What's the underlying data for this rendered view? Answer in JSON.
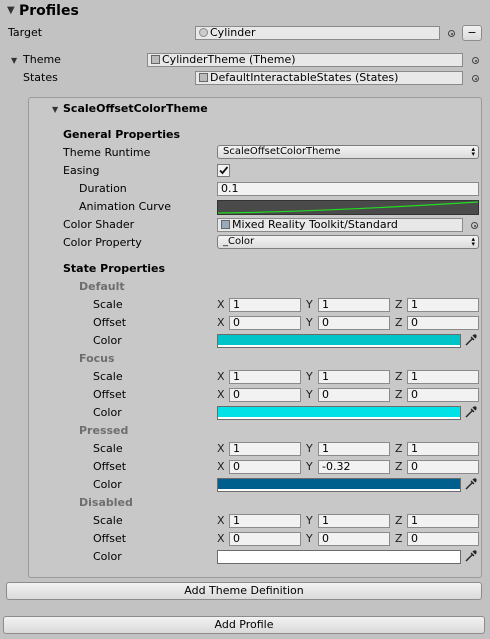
{
  "header": {
    "title": "Profiles"
  },
  "target": {
    "label": "Target",
    "value": "Cylinder"
  },
  "theme": {
    "label": "Theme",
    "value": "CylinderTheme (Theme)"
  },
  "states": {
    "label": "States",
    "value": "DefaultInteractableStates (States)"
  },
  "theme_box": {
    "title": "ScaleOffsetColorTheme",
    "general_heading": "General Properties",
    "theme_runtime": {
      "label": "Theme Runtime",
      "value": "ScaleOffsetColorTheme"
    },
    "easing": {
      "label": "Easing",
      "checked": true
    },
    "duration": {
      "label": "Duration",
      "value": "0.1"
    },
    "animation_curve": {
      "label": "Animation Curve",
      "line_color": "#22dd22"
    },
    "color_shader": {
      "label": "Color Shader",
      "value": "Mixed Reality Toolkit/Standard"
    },
    "color_property": {
      "label": "Color Property",
      "value": "_Color"
    },
    "state_heading": "State Properties",
    "axis": {
      "x": "X",
      "y": "Y",
      "z": "Z"
    },
    "row_labels": {
      "scale": "Scale",
      "offset": "Offset",
      "color": "Color"
    },
    "states": [
      {
        "name": "Default",
        "scale": [
          "1",
          "1",
          "1"
        ],
        "offset": [
          "0",
          "0",
          "0"
        ],
        "color": "#00c4c8"
      },
      {
        "name": "Focus",
        "scale": [
          "1",
          "1",
          "1"
        ],
        "offset": [
          "0",
          "0",
          "0"
        ],
        "color": "#00e2e6"
      },
      {
        "name": "Pressed",
        "scale": [
          "1",
          "1",
          "1"
        ],
        "offset": [
          "0",
          "-0.32",
          "0"
        ],
        "color": "#005f8c"
      },
      {
        "name": "Disabled",
        "scale": [
          "1",
          "1",
          "1"
        ],
        "offset": [
          "0",
          "0",
          "0"
        ],
        "color": "#ffffff"
      }
    ]
  },
  "buttons": {
    "add_theme_definition": "Add Theme Definition",
    "add_profile": "Add Profile",
    "minus": "−"
  }
}
